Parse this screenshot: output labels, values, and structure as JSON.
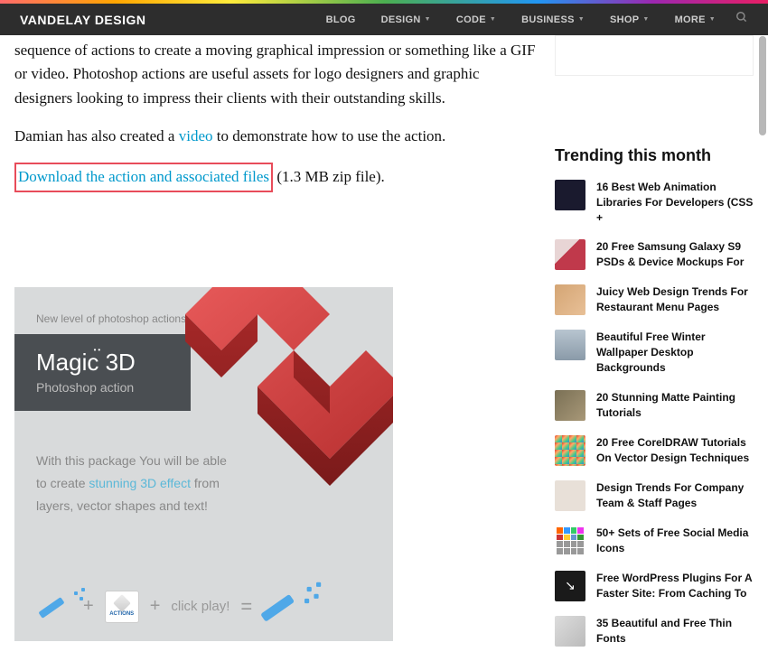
{
  "nav": {
    "brand": "VANDELAY DESIGN",
    "items": [
      "BLOG",
      "DESIGN",
      "CODE",
      "BUSINESS",
      "SHOP",
      "MORE"
    ]
  },
  "article": {
    "p1": "sequence of actions to create a moving graphical impression or something like a GIF or video. Photoshop actions are useful assets for logo designers and graphic designers looking to impress their clients with their outstanding skills.",
    "p2a": "Damian has also created a ",
    "p2link": "video",
    "p2b": " to demonstrate how to use the action.",
    "dl": "Download the action and associated files",
    "dlmeta": " (1.3 MB zip file)."
  },
  "promo": {
    "sub": "New level of photoshop actions!",
    "title1": "Mag",
    "title2": "c 3D",
    "subtitle": "Photoshop action",
    "body1": "With this package You will be able to create ",
    "bodylink": "stunning 3D effect",
    "body2": " from layers, vector shapes and text!",
    "click": "click play!",
    "actions": "ACTIONS"
  },
  "sidebar": {
    "heading": "Trending this month",
    "items": [
      "16 Best Web Animation Libraries For Developers (CSS +",
      "20 Free Samsung Galaxy S9 PSDs & Device Mockups For",
      "Juicy Web Design Trends For Restaurant Menu Pages",
      "Beautiful Free Winter Wallpaper Desktop Backgrounds",
      "20 Stunning Matte Painting Tutorials",
      "20 Free CorelDRAW Tutorials On Vector Design Techniques",
      "Design Trends For Company Team & Staff Pages",
      "50+ Sets of Free Social Media Icons",
      "Free WordPress Plugins For A Faster Site: From Caching To",
      "35 Beautiful and Free Thin Fonts"
    ]
  }
}
